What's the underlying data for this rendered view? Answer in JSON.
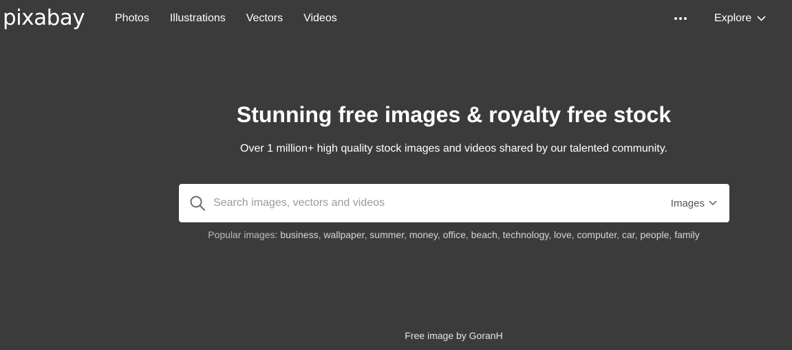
{
  "brand": {
    "logo_text": "pixabay"
  },
  "nav": {
    "items": [
      {
        "label": "Photos"
      },
      {
        "label": "Illustrations"
      },
      {
        "label": "Vectors"
      },
      {
        "label": "Videos"
      }
    ],
    "more_icon": "ellipsis-icon",
    "explore_label": "Explore",
    "explore_icon": "chevron-down-icon"
  },
  "hero": {
    "title": "Stunning free images & royalty free stock",
    "subtitle": "Over 1 million+ high quality stock images and videos shared by our talented community."
  },
  "search": {
    "icon": "search-icon",
    "placeholder": "Search images, vectors and videos",
    "value": "",
    "type_selected": "Images",
    "type_icon": "chevron-down-icon"
  },
  "popular": {
    "lead": "Popular images:",
    "tags": [
      "business",
      "wallpaper",
      "summer",
      "money",
      "office",
      "beach",
      "technology",
      "love",
      "computer",
      "car",
      "people",
      "family"
    ]
  },
  "credit": {
    "prefix": "Free image by",
    "author": "GoranH"
  },
  "colors": {
    "background": "#3b3b3b",
    "text": "#ffffff",
    "search_bg": "#ffffff"
  }
}
